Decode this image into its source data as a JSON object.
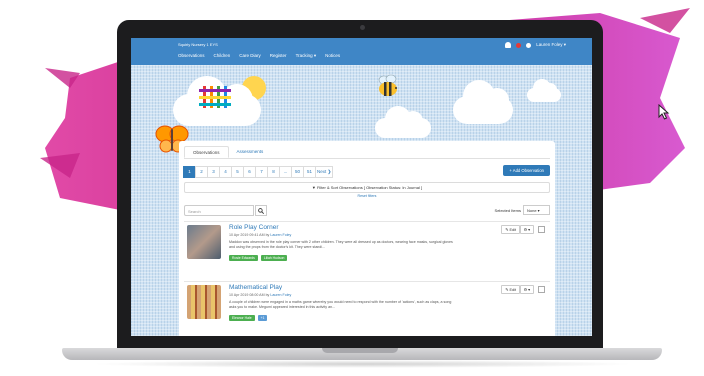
{
  "brand": "Squirly Nursery 1 EYS",
  "nav": {
    "links": [
      "Observations",
      "Children",
      "Care Diary",
      "Register",
      "Tracking ▾",
      "Notices"
    ],
    "user": "Lauren Foley ▾"
  },
  "tabs": [
    "Observations",
    "Assessments"
  ],
  "pagination": [
    "1",
    "2",
    "3",
    "4",
    "5",
    "6",
    "7",
    "8",
    "...",
    "50",
    "51",
    "Next ❯"
  ],
  "add_button": "+ Add Observation",
  "filter_bar": "▼ Filter & Sort Observations [ Observation Status: In Journal ]",
  "reset_link": "Reset filters",
  "search": {
    "placeholder": "Search"
  },
  "selected_items": {
    "label": "Selected Items",
    "value": "None ▾"
  },
  "observations": [
    {
      "title": "Role Play Corner",
      "date": "10 Apr 2019 09:41 AM by",
      "author": "Lauren Foley",
      "text": "Maddox was observed in the role play corner with 2 other children. They were all dressed up as doctors, wearing face masks, surgical gloves and using the props from the doctor's kit. They were standi...",
      "tags": [
        "Rosie Edwards",
        "Liliah Hudson"
      ],
      "edit": "✎ Edit",
      "gear": "⚙ ▾"
    },
    {
      "title": "Mathematical Play",
      "date": "10 Apr 2019 08:00 AM by",
      "author": "Lauren Foley",
      "text": "A couple of children were engaged in a maths game whereby you would need to respond with the number of 'actions', such as claps, a song asks you to make. Megumi appeared interested in this activity an...",
      "tags": [
        "Eleanor Hale",
        "+1"
      ],
      "edit": "✎ Edit",
      "gear": "⚙ ▾"
    }
  ],
  "colors": {
    "nav": "#3f86c6",
    "accent": "#2f7ab8",
    "splash": "#c8268a",
    "tag": "#4caf50"
  }
}
